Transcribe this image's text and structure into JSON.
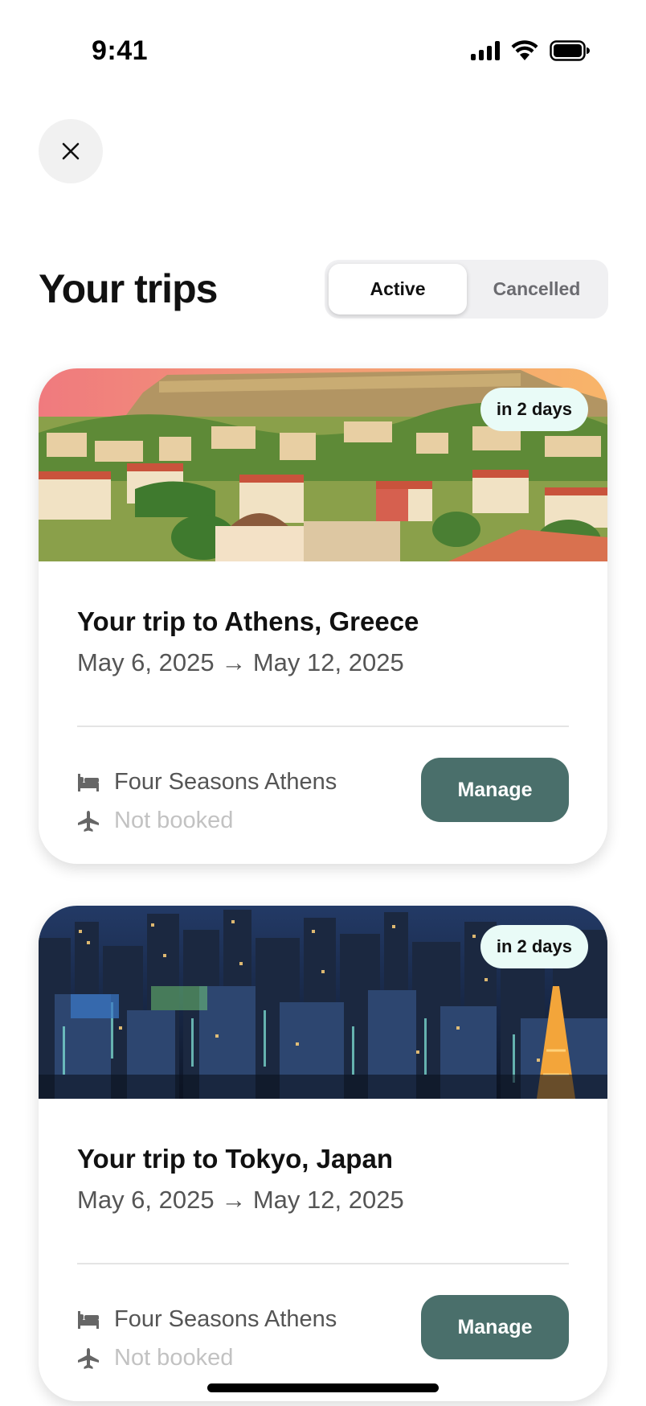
{
  "status_bar": {
    "time": "9:41"
  },
  "header": {
    "title": "Your trips",
    "close_icon": "close-icon"
  },
  "tabs": [
    {
      "label": "Active",
      "selected": true
    },
    {
      "label": "Cancelled",
      "selected": false
    }
  ],
  "trips": [
    {
      "title": "Your trip to Athens, Greece",
      "dates": "May 6, 2025 → May 12, 2025",
      "badge": "in 2 days",
      "hotel": "Four Seasons Athens",
      "flight": "Not booked",
      "action": "Manage",
      "image": "athens-photo"
    },
    {
      "title": "Your trip to Tokyo, Japan",
      "dates": "May 6, 2025 → May 12, 2025",
      "badge": "in 2 days",
      "hotel": "Four Seasons Athens",
      "flight": "Not booked",
      "action": "Manage",
      "image": "tokyo-photo"
    }
  ],
  "colors": {
    "accent": "#4a6f6b",
    "badge_bg": "#e9fbf7",
    "segment_bg": "#f0f0f2"
  }
}
